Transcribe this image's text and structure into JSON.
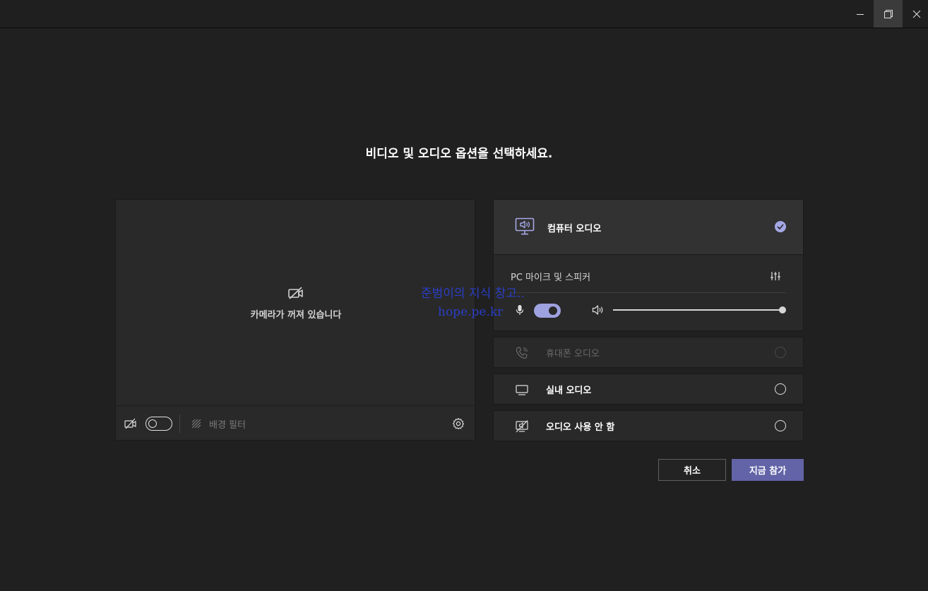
{
  "heading": "비디오 및 오디오 옵션을 선택하세요.",
  "window_controls": {
    "minimize": "minimize",
    "restore": "restore",
    "close": "close"
  },
  "preview": {
    "camera_off_text": "카메라가 꺼져 있습니다",
    "camera_toggle_on": false,
    "background_filter_label": "배경 필터"
  },
  "audio_options": {
    "computer_audio": {
      "label": "컴퓨터 오디오",
      "selected": true,
      "device_label": "PC 마이크 및 스피커",
      "mic_on": true,
      "volume_level": 1.0
    },
    "phone_audio": {
      "label": "휴대폰 오디오",
      "enabled": false,
      "selected": false
    },
    "room_audio": {
      "label": "실내 오디오",
      "selected": false
    },
    "no_audio": {
      "label": "오디오 사용 안 함",
      "selected": false
    }
  },
  "watermark": {
    "line1": "준범이의 지식 창고..",
    "line2": "hope.pe.kr"
  },
  "buttons": {
    "cancel": "취소",
    "join_now": "지금 참가"
  },
  "colors": {
    "background": "#202020",
    "panel": "#292929",
    "accent": "#6264a7",
    "toggle_accent": "#9ea2e0",
    "watermark": "#2a3ec7"
  }
}
